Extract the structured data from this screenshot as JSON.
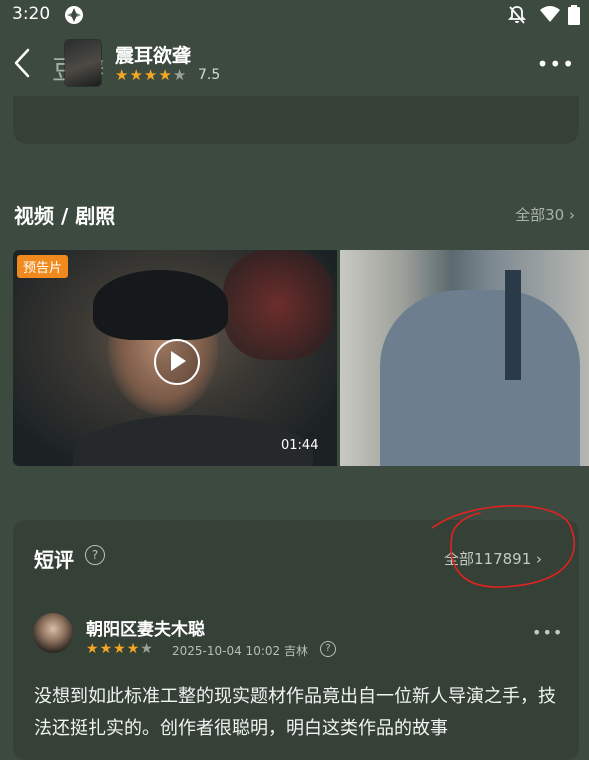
{
  "status_bar": {
    "time": "3:20"
  },
  "header": {
    "ghost_title": "豆瓣",
    "title": "震耳欲聋",
    "rating": "7.5",
    "stars_full": 4,
    "stars_total": 5,
    "more": "•••"
  },
  "media": {
    "title": "视频 / 剧照",
    "all": "全部30 ›",
    "badge": "预告片",
    "duration": "01:44"
  },
  "reviews": {
    "title": "短评",
    "help": "?",
    "all": "全部117891 ›",
    "items": [
      {
        "user": "朝阳区妻夫木聪",
        "stars_full": 4,
        "date_location": "2025-10-04 10:02 吉林",
        "more": "•••",
        "text": "没想到如此标准工整的现实题材作品竟出自一位新人导演之手，技法还挺扎实的。创作者很聪明，明白这类作品的故事"
      }
    ]
  },
  "colors": {
    "background": "#3d4a3f",
    "card": "#354036",
    "accent_orange": "#f08a1e",
    "star": "#f5a623",
    "annotation": "#e0231f"
  }
}
